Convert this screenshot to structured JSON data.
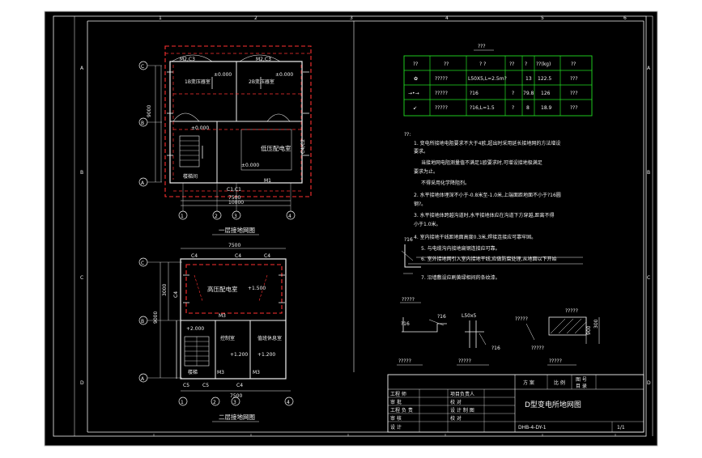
{
  "drawing": {
    "title_block_title": "D型变电所地网图",
    "plan_upper_caption": "一层接地网图",
    "plan_lower_caption": "二层接地网图",
    "materials_table": {
      "title": "???",
      "headers": [
        "??",
        "??",
        "? ?",
        "??",
        "?",
        "??(kg)",
        "??"
      ],
      "rows": [
        [
          "✿",
          "?????",
          "L50X5,L=2.5m?",
          "13",
          "122.5",
          "???"
        ],
        [
          "→•→",
          "?????",
          "?16",
          "?",
          "79.8",
          "126",
          "???"
        ],
        [
          "↙",
          "?????",
          "?16,L=1.5",
          "?",
          "8",
          "18.9",
          "???"
        ]
      ]
    },
    "notes": {
      "heading": "??:",
      "lines": [
        "1. 变电所接地电阻要求不大于4欧,超出时采用延长接地网的方法增设",
        "要求。",
        "当接地网电阻测量值不满足1欧要求时,可增设接地极满足",
        "要求为止。",
        "不得采用化学降阻剂。",
        "2. 水平接地体埋深不小于-0.8米至-1.0米,上端面距地面不小于?16圆",
        "钢?。",
        "3. 水平接地体跨越沟道时,水平接地体应在沟道下方穿越,距离不得",
        "小于1.0米。",
        "4. 室内接地干线距地面高度0.3米,焊接连接应可靠牢固。",
        "5. 与电缆沟内接地扁钢连接应可靠。",
        "6. 室外接地网引入室内接地干线,应做防腐处理,从地面以下开始",
        "7. 沿墙敷设应刷黄绿相间的条纹漆。"
      ]
    },
    "detail_labels": [
      "?16",
      "?????",
      "L50x5",
      "?16",
      "?????",
      "?????",
      "?????",
      "?????",
      "?????",
      "?????",
      "900",
      "300",
      "?????"
    ],
    "upper_plan": {
      "axis_rows": [
        "C",
        "B",
        "A"
      ],
      "axis_cols": [
        "1",
        "2",
        "3",
        "4"
      ],
      "rooms": [
        "1B变压器室",
        "2B变压器室",
        "低压配电室",
        "楼梯间"
      ],
      "labels": [
        "M2,C3",
        "M2,C3",
        "±0.000",
        "±0.000",
        "±0.000",
        "±0.000",
        "C1,C1",
        "M1",
        "C4/C2",
        "M1",
        "7500",
        "10000",
        "9000"
      ]
    },
    "lower_plan": {
      "axis_rows": [
        "C",
        "B",
        "A"
      ],
      "room_labels": [
        "高压配电室",
        "控制室",
        "值班休息室",
        "楼梯"
      ],
      "labels": [
        "C4",
        "C4",
        "C4",
        "C4",
        "+1.500",
        "M3",
        "M3",
        "M3",
        "C5",
        "C5",
        "C4",
        "+2.000",
        "+1.200",
        "+1.200",
        "7500",
        "7500",
        "9000",
        "3000"
      ]
    },
    "title_block": {
      "rows_left": [
        "工程 师",
        "审 批",
        "工程 负 责",
        "审 核",
        "专业 负 责",
        "设 计"
      ],
      "rows_mid": [
        "项目负责人",
        "校 对",
        "设 计 制 图",
        "校 对"
      ],
      "right_top": [
        "方 案",
        "比 例",
        "图 号",
        "目 录"
      ],
      "drawing_no": "DHB-4-DY-1",
      "sheet": "1/1"
    },
    "border_marks_left": [
      "A",
      "B",
      "C",
      "D"
    ],
    "border_marks_right": [
      "A",
      "B",
      "C",
      "D"
    ],
    "border_marks_top": [
      "1",
      "2",
      "3",
      "4",
      "5",
      "6"
    ],
    "colors": {
      "background": "#000000",
      "frame_outer": "#c0c0c0",
      "lines": "#f2f2f2",
      "ground_red": "#ff3030",
      "table_green": "#22dd22"
    }
  }
}
